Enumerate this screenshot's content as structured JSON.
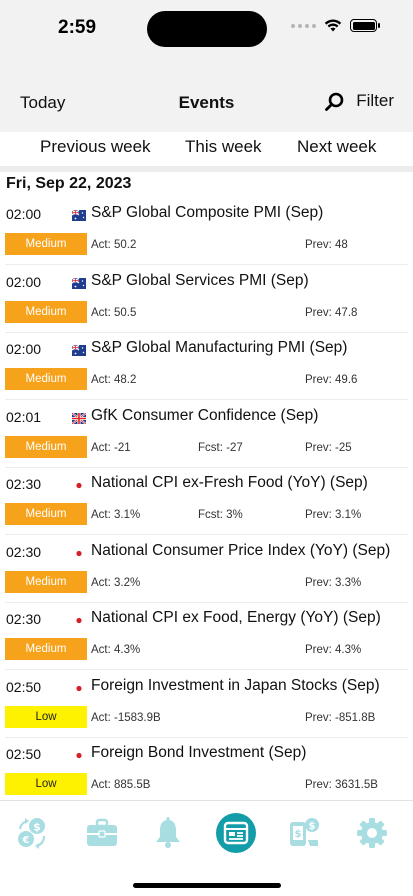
{
  "status_bar": {
    "time": "2:59"
  },
  "nav": {
    "today_label": "Today",
    "title": "Events",
    "filter_label": "Filter"
  },
  "week_tabs": {
    "previous": "Previous week",
    "this": "This week",
    "next": "Next week"
  },
  "date_header": "Fri, Sep 22, 2023",
  "events": [
    {
      "time": "02:00",
      "country": "Australia",
      "title": "S&P Global Composite PMI (Sep)",
      "impact": "Medium",
      "act": "Act: 50.2",
      "fcst": "",
      "prev": "Prev: 48"
    },
    {
      "time": "02:00",
      "country": "Australia",
      "title": "S&P Global Services PMI (Sep)",
      "impact": "Medium",
      "act": "Act: 50.5",
      "fcst": "",
      "prev": "Prev: 47.8"
    },
    {
      "time": "02:00",
      "country": "Australia",
      "title": "S&P Global Manufacturing PMI (Sep)",
      "impact": "Medium",
      "act": "Act: 48.2",
      "fcst": "",
      "prev": "Prev: 49.6"
    },
    {
      "time": "02:01",
      "country": "United Kingdom",
      "title": "GfK Consumer Confidence (Sep)",
      "impact": "Medium",
      "act": "Act: -21",
      "fcst": "Fcst: -27",
      "prev": "Prev: -25"
    },
    {
      "time": "02:30",
      "country": "Japan",
      "title": "National CPI ex-Fresh Food (YoY) (Sep)",
      "impact": "Medium",
      "act": "Act: 3.1%",
      "fcst": "Fcst: 3%",
      "prev": "Prev: 3.1%"
    },
    {
      "time": "02:30",
      "country": "Japan",
      "title": "National Consumer Price Index (YoY) (Sep)",
      "impact": "Medium",
      "act": "Act: 3.2%",
      "fcst": "",
      "prev": "Prev: 3.3%"
    },
    {
      "time": "02:30",
      "country": "Japan",
      "title": "National CPI ex Food, Energy (YoY) (Sep)",
      "impact": "Medium",
      "act": "Act: 4.3%",
      "fcst": "",
      "prev": "Prev: 4.3%"
    },
    {
      "time": "02:50",
      "country": "Japan",
      "title": "Foreign Investment in Japan Stocks (Sep)",
      "impact": "Low",
      "act": "Act: -1583.9B",
      "fcst": "",
      "prev": "Prev: -851.8B"
    },
    {
      "time": "02:50",
      "country": "Japan",
      "title": "Foreign Bond Investment (Sep)",
      "impact": "Low",
      "act": "Act: 885.5B",
      "fcst": "",
      "prev": "Prev: 3631.5B"
    }
  ],
  "tab_bar": [
    {
      "icon": "currency-exchange-icon",
      "active": false
    },
    {
      "icon": "briefcase-icon",
      "active": false
    },
    {
      "icon": "bell-icon",
      "active": false
    },
    {
      "icon": "calendar-news-icon",
      "active": true
    },
    {
      "icon": "money-transfer-icon",
      "active": false
    },
    {
      "icon": "gear-icon",
      "active": false
    }
  ],
  "colors": {
    "medium": "#f7a21b",
    "low": "#fff200",
    "accent": "#129da8",
    "tab_icon": "#a8dde2"
  }
}
